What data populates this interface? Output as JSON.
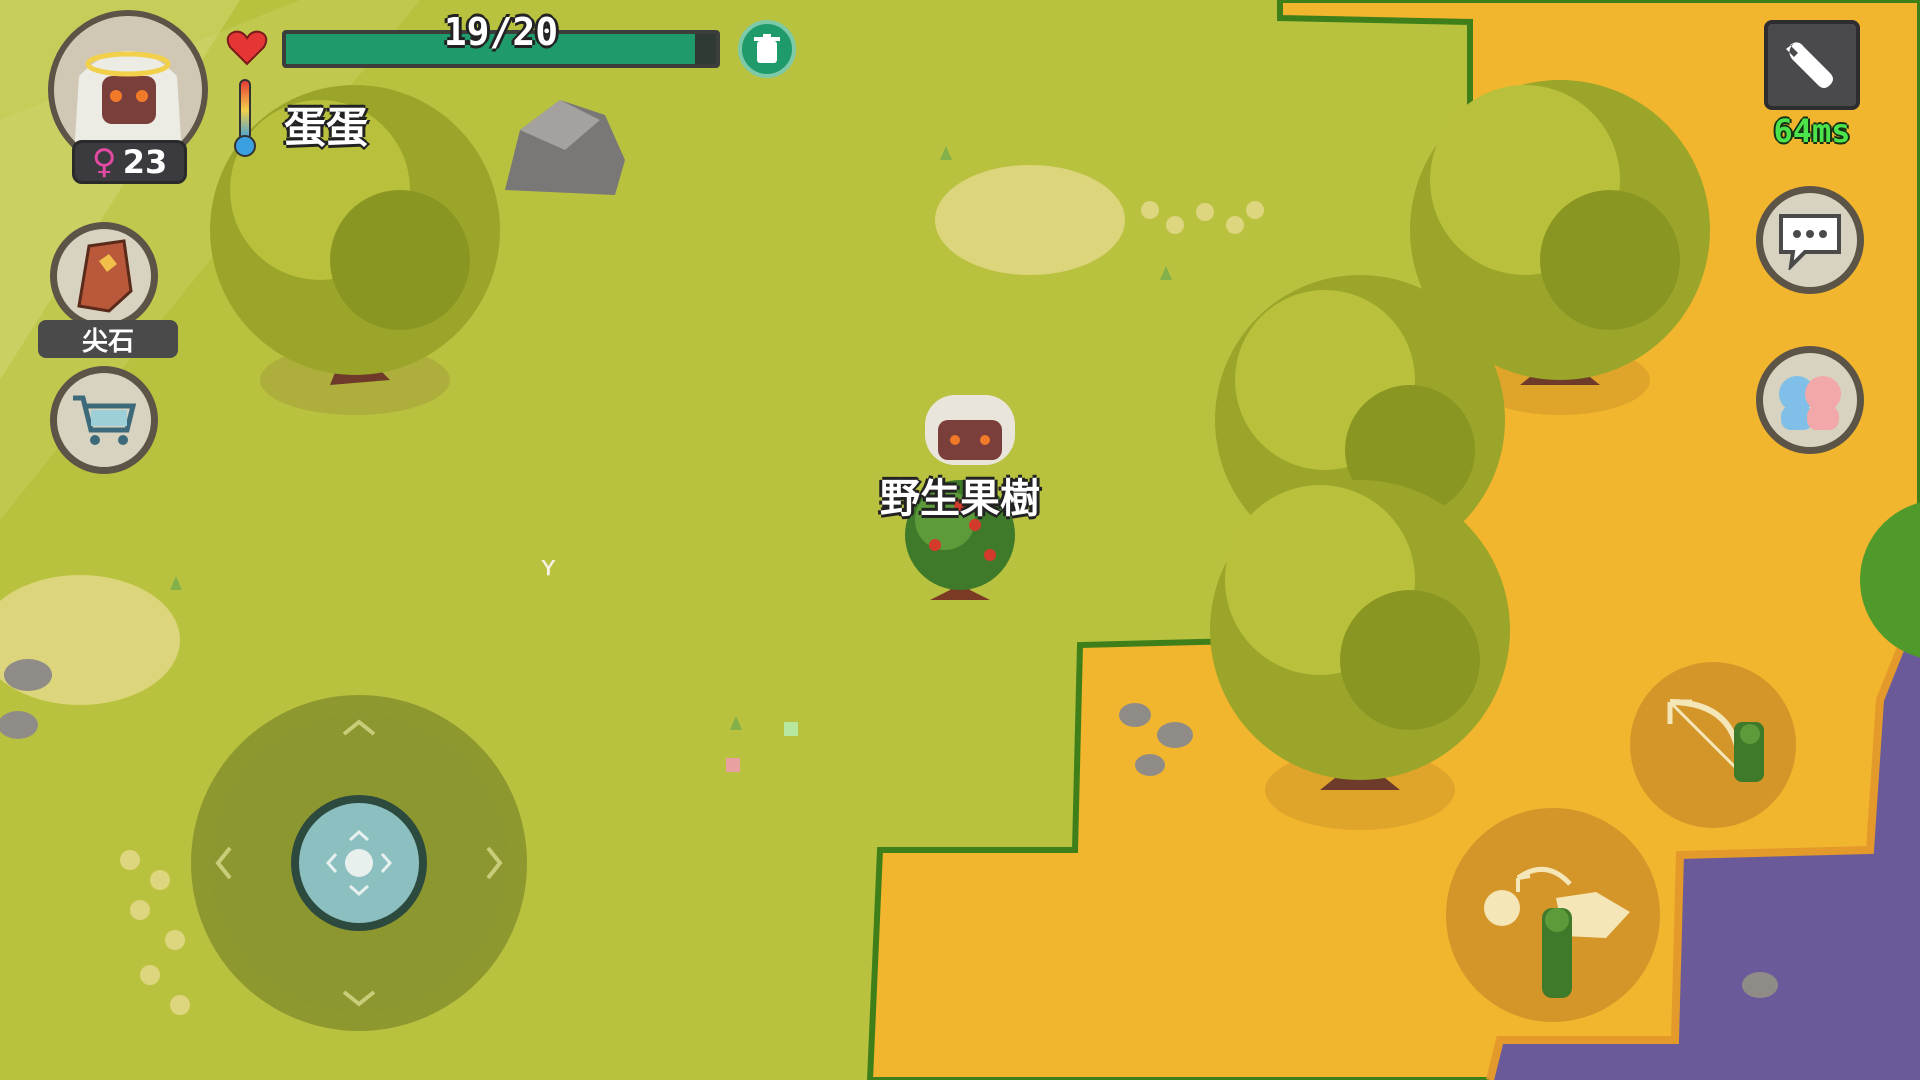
{
  "player": {
    "hp_text": "19/20",
    "hp_fraction": 0.95,
    "name": "蛋蛋",
    "level": "23"
  },
  "equipped_item": {
    "label": "尖石"
  },
  "network": {
    "ping": "64ms"
  },
  "world": {
    "target_label": "野生果樹"
  },
  "colors": {
    "grass": "#b9c23f",
    "sand": "#f2b52e",
    "water": "#6a5a9a",
    "hp_fill": "#1f9a6b",
    "ping": "#4de34a"
  },
  "icons": {
    "heart": "heart-icon",
    "thermometer": "thermometer-icon",
    "trash": "trash-icon",
    "settings": "wrench-icon",
    "chat": "chat-bubble-icon",
    "friends": "friends-icon",
    "shop": "shopping-cart-icon",
    "bow": "bow-icon",
    "dodge": "dodge-roll-icon"
  }
}
